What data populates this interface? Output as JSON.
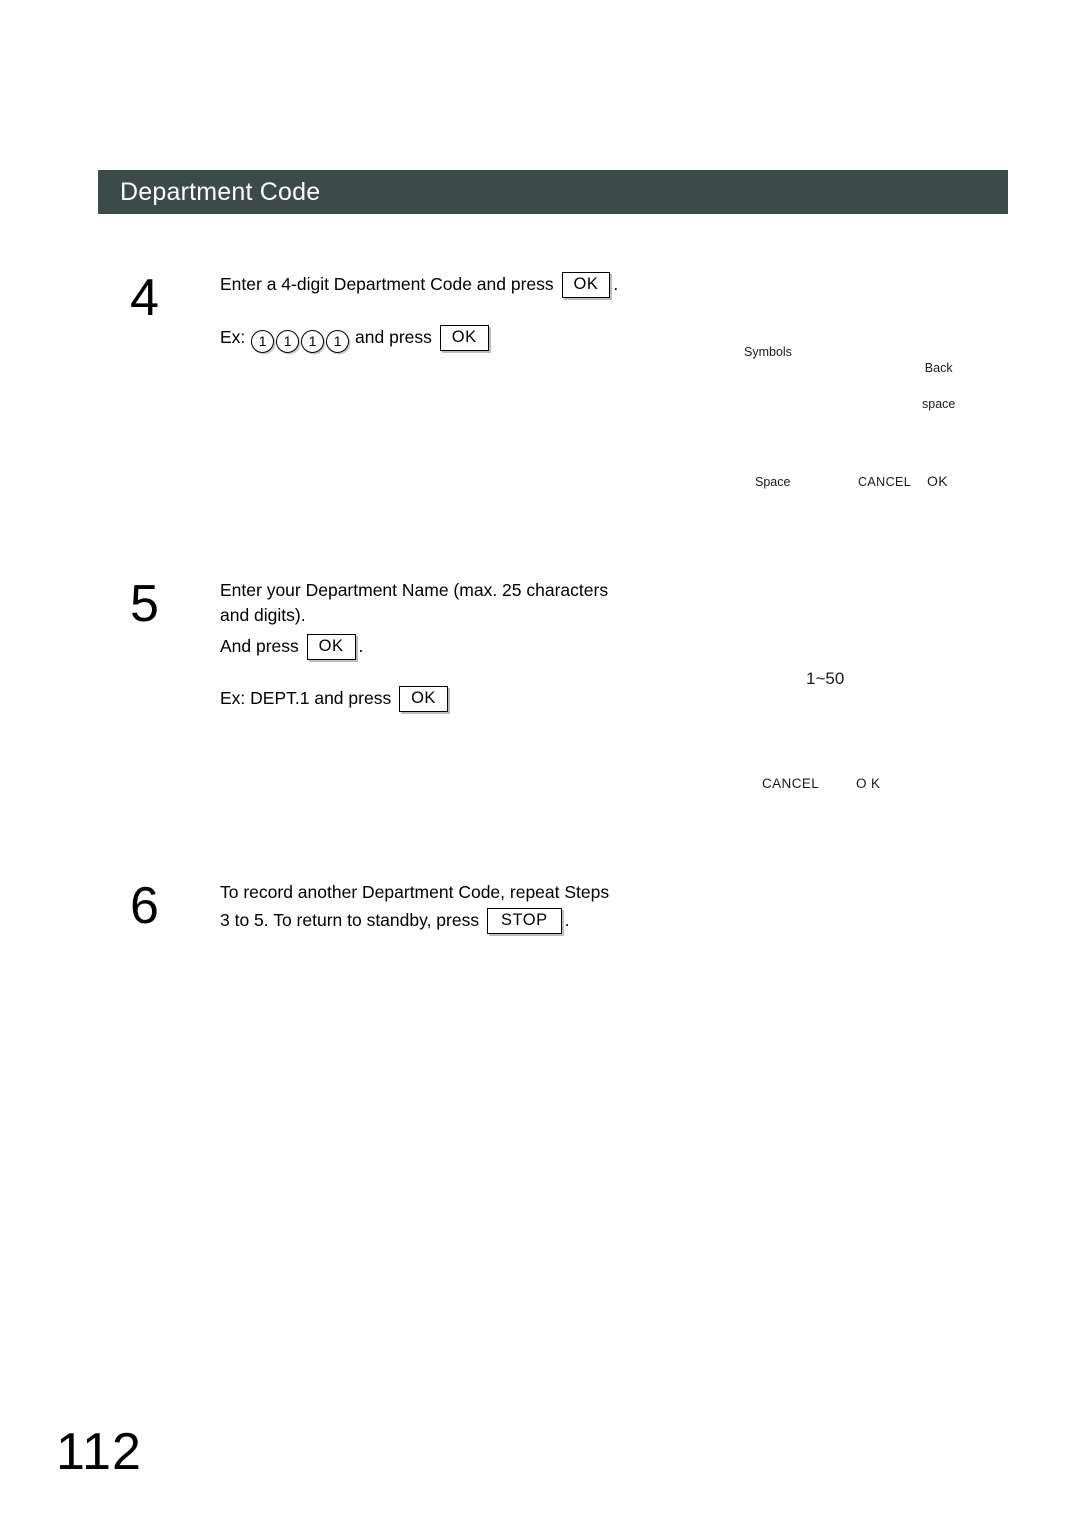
{
  "page": {
    "section_title": "Department Code",
    "page_number": "112",
    "header_color": "#3d4a4a"
  },
  "steps": [
    {
      "number": "4",
      "line1_a": "Enter a 4-digit Department Code and press",
      "key1": "OK",
      "line1_b": ".",
      "line2_a": "Ex:",
      "digits": [
        "1",
        "1",
        "1",
        "1"
      ],
      "line2_b": "and press",
      "key2": "OK"
    },
    {
      "number": "5",
      "line1": "Enter your Department Name (max. 25 characters",
      "line2": "and digits).",
      "line3_a": "And press",
      "key1": "OK",
      "line3_b": ".",
      "line4_a": "Ex: DEPT.1 and press",
      "key2": "OK"
    },
    {
      "number": "6",
      "line1": "To record another Department Code, repeat Steps",
      "line2_a": "3 to 5. To return to standby, press",
      "key1": "STOP",
      "line2_b": "."
    }
  ],
  "display_panels": [
    {
      "name": "character-entry-display",
      "labels": {
        "symbols": "Symbols",
        "backspace_line1": "Back",
        "backspace_line2": "space",
        "space": "Space",
        "cancel": "CANCEL",
        "ok": "OK"
      }
    },
    {
      "name": "department-name-display",
      "labels": {
        "range": "1~50",
        "cancel": "CANCEL",
        "ok": "O K"
      }
    }
  ]
}
